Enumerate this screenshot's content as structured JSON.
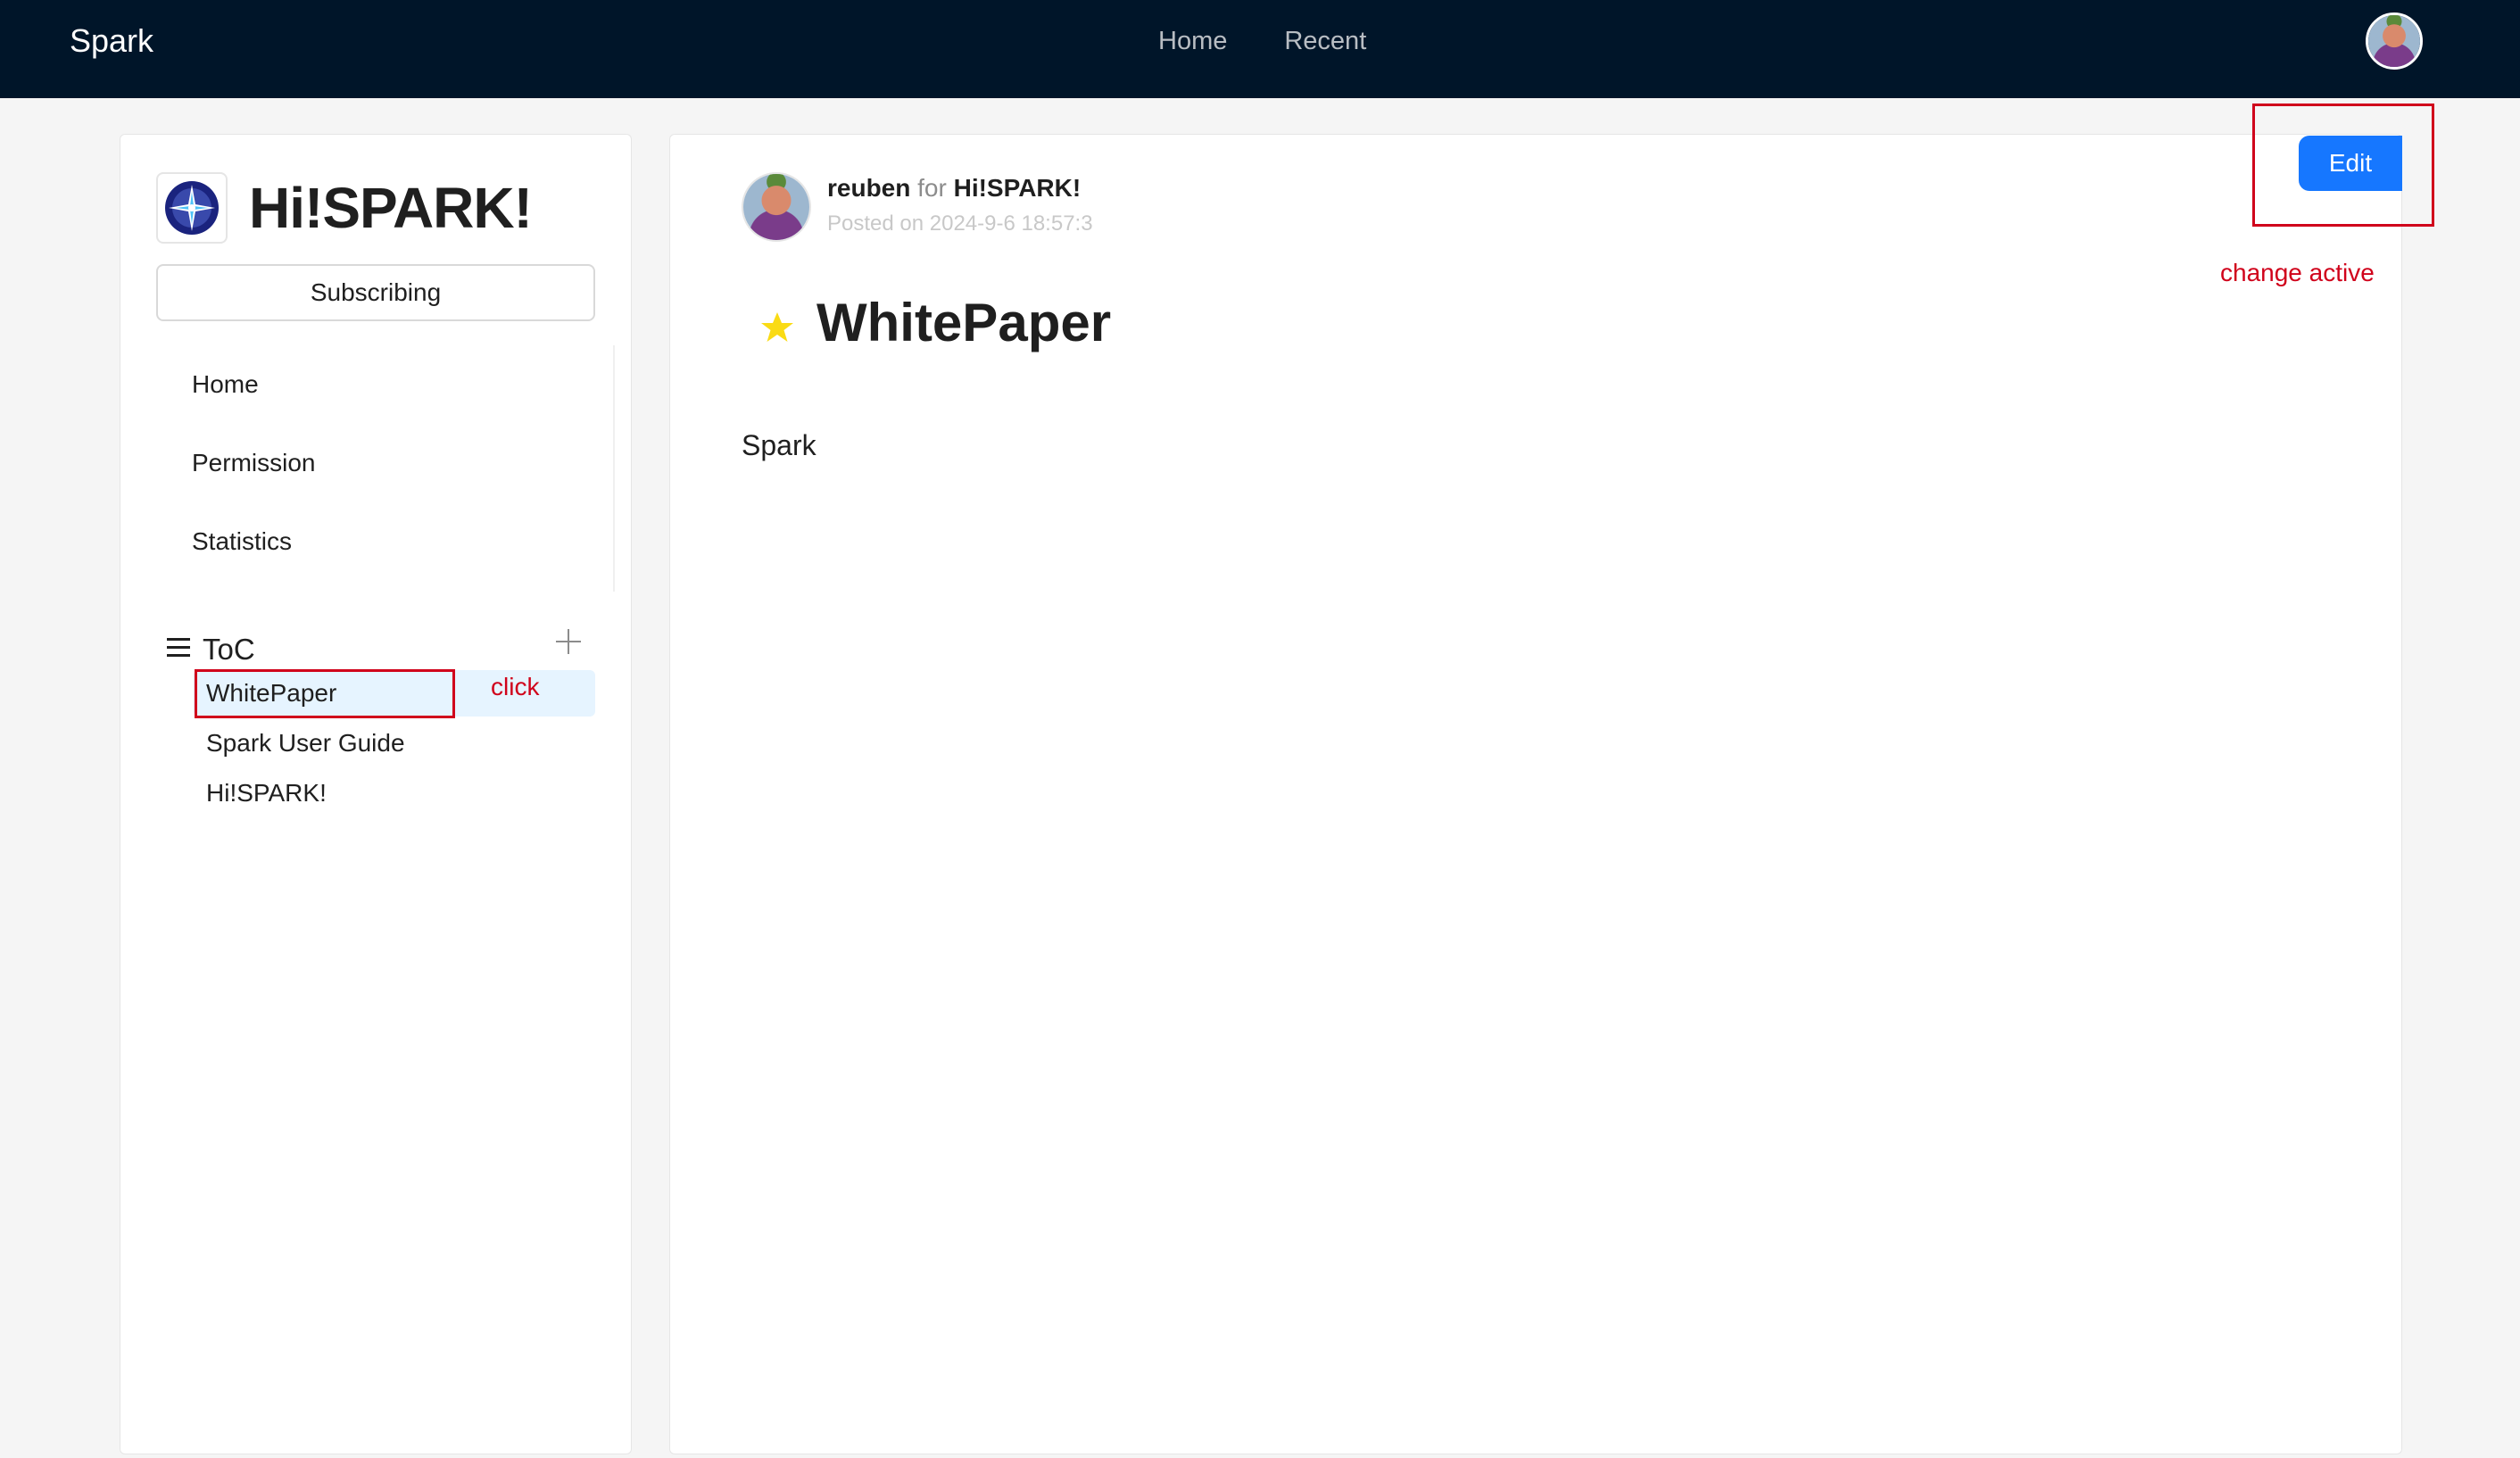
{
  "topbar": {
    "brand": "Spark",
    "nav": [
      "Home",
      "Recent"
    ]
  },
  "space": {
    "title": "Hi!SPARK!",
    "subscribe_label": "Subscribing",
    "menu": [
      "Home",
      "Permission",
      "Statistics"
    ]
  },
  "toc": {
    "title": "ToC",
    "items": [
      "WhitePaper",
      "Spark User Guide",
      "Hi!SPARK!"
    ],
    "active_index": 0
  },
  "post": {
    "author": "reuben",
    "for_word": "for",
    "space": "Hi!SPARK!",
    "posted": "Posted on 2024-9-6 18:57:3",
    "title": "WhitePaper",
    "body": "Spark",
    "edit_label": "Edit"
  },
  "annotations": {
    "click": "click",
    "change_active": "change active"
  },
  "colors": {
    "topbar": "#001529",
    "primary": "#1677ff",
    "active_bg": "#e6f4ff",
    "annotation": "#d0021b",
    "star": "#fadb14"
  }
}
